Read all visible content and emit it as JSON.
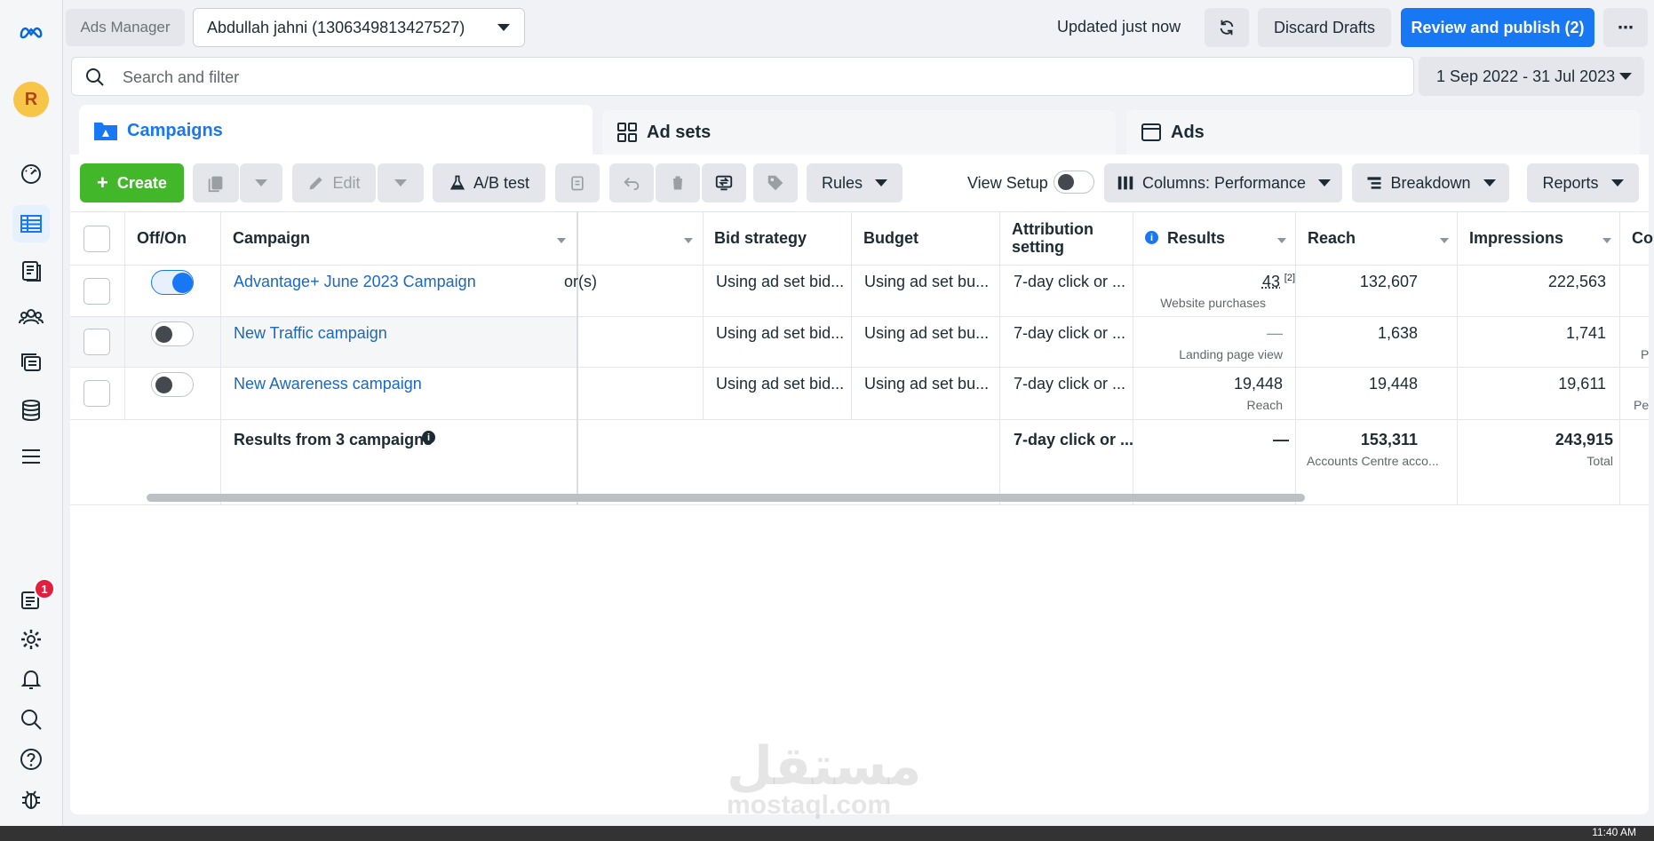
{
  "app": {
    "title": "Ads Manager"
  },
  "account": {
    "name": "Abdullah jahni (1306349813427527)"
  },
  "avatar": {
    "initial": "R"
  },
  "header": {
    "updated": "Updated just now",
    "discard_label": "Discard Drafts",
    "publish_label": "Review and publish (2)",
    "more_label": "⋯"
  },
  "search": {
    "placeholder": "Search and filter"
  },
  "date_range": "1 Sep 2022 - 31 Jul 2023",
  "tabs": [
    {
      "label": "Campaigns"
    },
    {
      "label": "Ad sets"
    },
    {
      "label": "Ads"
    }
  ],
  "toolbar": {
    "create": "Create",
    "edit": "Edit",
    "ab_test": "A/B test",
    "rules": "Rules",
    "view_setup": "View Setup",
    "columns": "Columns: Performance",
    "breakdown": "Breakdown",
    "reports": "Reports"
  },
  "nav": {
    "notification_count": "1"
  },
  "table": {
    "headers": {
      "on_off": "Off/On",
      "campaign": "Campaign",
      "bid_strategy": "Bid strategy",
      "budget": "Budget",
      "attribution": "Attribution setting",
      "results": "Results",
      "reach": "Reach",
      "impressions": "Impressions",
      "cost": "Co"
    },
    "rows": [
      {
        "on": true,
        "name": "Advantage+ June 2023 Campaign",
        "hidden_col": "or(s)",
        "bid": "Using ad set bid...",
        "budget": "Using ad set bu...",
        "attribution": "7-day click or ...",
        "results": "43",
        "results_note": "[2]",
        "results_sub": "Website purchases",
        "reach": "132,607",
        "impressions": "222,563",
        "cost_sub": ""
      },
      {
        "on": false,
        "name": "New Traffic campaign",
        "hidden_col": "",
        "bid": "Using ad set bid...",
        "budget": "Using ad set bu...",
        "attribution": "7-day click or ...",
        "results": "—",
        "results_note": "",
        "results_sub": "Landing page view",
        "reach": "1,638",
        "impressions": "1,741",
        "cost_sub": "P"
      },
      {
        "on": false,
        "name": "New Awareness campaign",
        "hidden_col": "",
        "bid": "Using ad set bid...",
        "budget": "Using ad set bu...",
        "attribution": "7-day click or ...",
        "results": "19,448",
        "results_note": "",
        "results_sub": "Reach",
        "reach": "19,448",
        "impressions": "19,611",
        "cost_sub": "Pe"
      }
    ],
    "totals": {
      "label": "Results from 3 campaigns",
      "attribution": "7-day click or ...",
      "results": "—",
      "reach": "153,311",
      "reach_sub": "Accounts Centre acco...",
      "impressions": "243,915",
      "impressions_sub": "Total"
    }
  },
  "watermark": {
    "arabic": "مستقل",
    "latin": "mostaql.com"
  },
  "clock": "11:40 AM"
}
